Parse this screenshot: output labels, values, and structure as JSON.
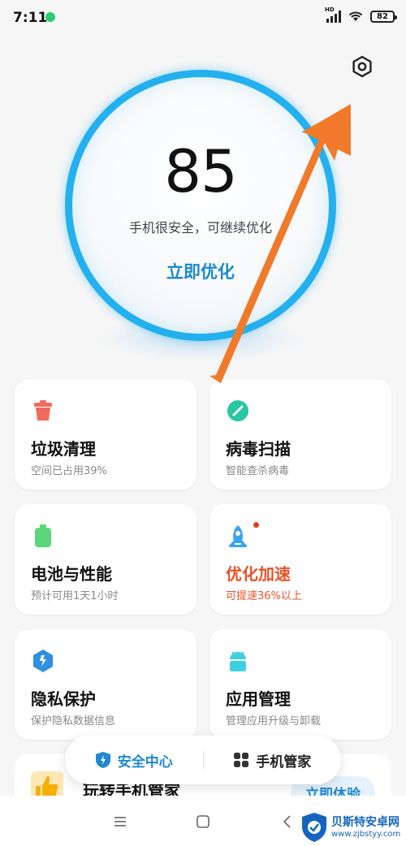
{
  "status_bar": {
    "time": "7:11",
    "network_label": "HD",
    "battery_level": "82"
  },
  "score": {
    "value": "85",
    "description": "手机很安全，可继续优化",
    "action": "立即优化"
  },
  "cards": [
    {
      "title": "垃圾清理",
      "subtitle": "空间已占用39%",
      "icon": "trash-icon",
      "color": "#f06b5b"
    },
    {
      "title": "病毒扫描",
      "subtitle": "智能查杀病毒",
      "icon": "virus-scan-icon",
      "color": "#27c7a2"
    },
    {
      "title": "电池与性能",
      "subtitle": "预计可用1天1小时",
      "icon": "battery-icon",
      "color": "#5cd67a"
    },
    {
      "title": "优化加速",
      "subtitle": "可提速36%以上",
      "icon": "rocket-icon",
      "color": "#3ba4f0"
    },
    {
      "title": "隐私保护",
      "subtitle": "保护隐私数据信息",
      "icon": "privacy-shield-icon",
      "color": "#2f8fe0"
    },
    {
      "title": "应用管理",
      "subtitle": "管理应用升级与卸载",
      "icon": "android-icon",
      "color": "#3fd0e0"
    }
  ],
  "promo": {
    "title": "玩转手机管家",
    "button": "立即体验"
  },
  "tabs": [
    {
      "label": "安全中心",
      "active": true
    },
    {
      "label": "手机管家",
      "active": false
    }
  ],
  "watermark": {
    "name": "贝斯特安卓网",
    "url": "www.zjbstyy.com"
  },
  "colors": {
    "accent": "#1e88d0",
    "ring": "#23b0ee",
    "highlight": "#e8542a",
    "arrow": "#f07a2a"
  }
}
